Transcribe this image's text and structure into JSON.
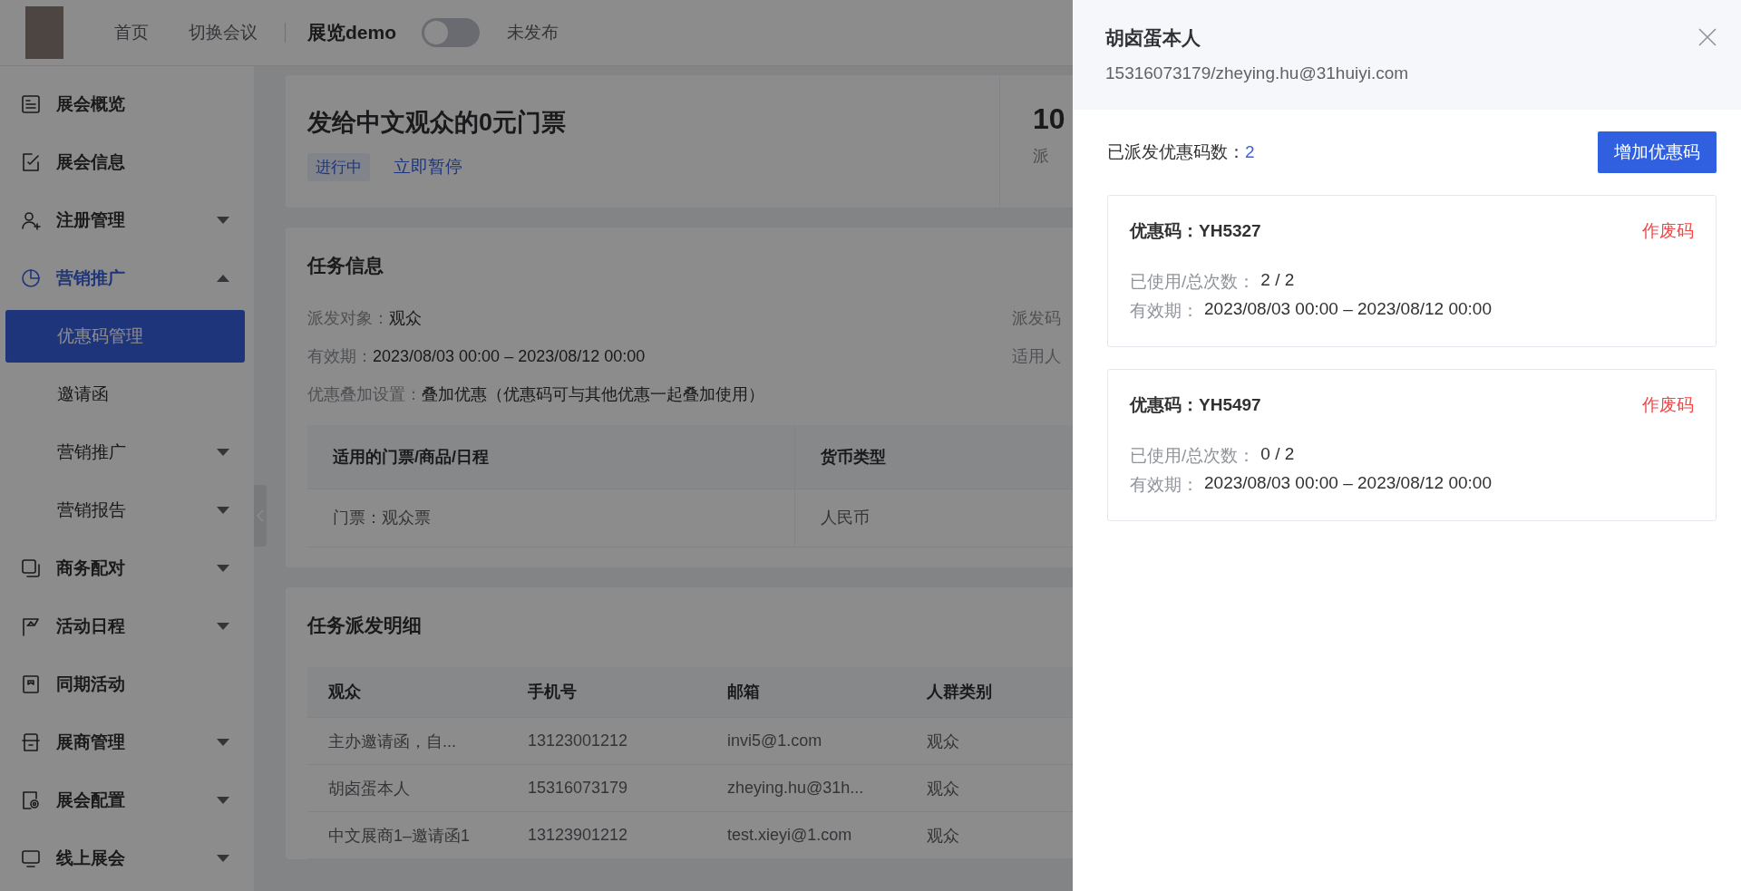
{
  "header": {
    "nav": [
      {
        "label": "首页"
      },
      {
        "label": "切换会议"
      }
    ],
    "project_title": "展览demo",
    "publish_toggle": {
      "on": false
    },
    "publish_status": "未发布"
  },
  "sidebar": {
    "items": [
      {
        "label": "展会概览",
        "selected": false
      },
      {
        "label": "展会信息",
        "selected": false
      },
      {
        "label": "注册管理",
        "selected": false,
        "expanded": false
      },
      {
        "label": "营销推广",
        "expanded": true,
        "children": [
          {
            "label": "优惠码管理",
            "selected": true
          },
          {
            "label": "邀请函",
            "selected": false
          },
          {
            "label": "营销推广",
            "selected": false,
            "expanded": false
          },
          {
            "label": "营销报告",
            "selected": false,
            "expanded": false
          }
        ]
      },
      {
        "label": "商务配对",
        "selected": false,
        "expanded": false
      },
      {
        "label": "活动日程",
        "selected": false,
        "expanded": false
      },
      {
        "label": "同期活动",
        "selected": false
      },
      {
        "label": "展商管理",
        "selected": false,
        "expanded": false
      },
      {
        "label": "展会配置",
        "selected": false,
        "expanded": false
      },
      {
        "label": "线上展会",
        "selected": false,
        "expanded": false
      }
    ]
  },
  "task_card": {
    "title": "发给中文观众的0元门票",
    "status": "进行中",
    "action": "立即暂停",
    "stat_value": "10",
    "stat_label": "派"
  },
  "task_info": {
    "title": "任务信息",
    "fields": [
      {
        "label": "派发对象：",
        "value": "观众"
      },
      {
        "label": "有效期：",
        "value": "2023/08/03 00:00 – 2023/08/12 00:00"
      },
      {
        "label": "优惠叠加设置：",
        "value": "叠加优惠（优惠码可与其他优惠一起叠加使用）"
      }
    ],
    "side_fields": [
      {
        "label": "派发码"
      },
      {
        "label": "适用人"
      }
    ],
    "table": {
      "columns": [
        "适用的门票/商品/日程",
        "货币类型"
      ],
      "rows": [
        [
          "门票：观众票",
          "人民币"
        ]
      ]
    }
  },
  "dispatch": {
    "title": "任务派发明细",
    "table": {
      "columns": [
        "观众",
        "手机号",
        "邮箱",
        "人群类别"
      ],
      "rows": [
        [
          "主办邀请函，自...",
          "13123001212",
          "invi5@1.com",
          "观众"
        ],
        [
          "胡卤蛋本人",
          "15316073179",
          "zheying.hu@31h...",
          "观众"
        ],
        [
          "中文展商1–邀请函1",
          "13123901212",
          "test.xieyi@1.com",
          "观众"
        ]
      ]
    }
  },
  "drawer": {
    "name": "胡卤蛋本人",
    "contact": "15316073179/zheying.hu@31huiyi.com",
    "count_label": "已派发优惠码数：",
    "count": "2",
    "add_button": "增加优惠码",
    "codes": [
      {
        "code": "优惠码：YH5327",
        "void_action": "作废码",
        "usage_label": "已使用/总次数：",
        "usage": "2 / 2",
        "validity_label": "有效期：",
        "validity": "2023/08/03 00:00 – 2023/08/12 00:00"
      },
      {
        "code": "优惠码：YH5497",
        "void_action": "作废码",
        "usage_label": "已使用/总次数：",
        "usage": "0 / 2",
        "validity_label": "有效期：",
        "validity": "2023/08/03 00:00 – 2023/08/12 00:00"
      }
    ]
  }
}
